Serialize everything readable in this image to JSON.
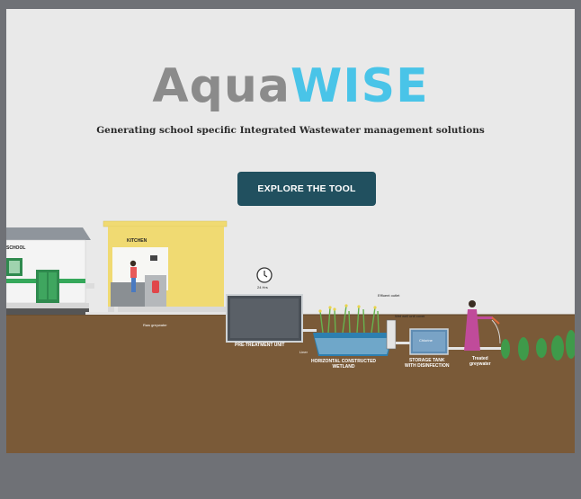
{
  "brand": {
    "part1": "Aqua",
    "part2": "WISE",
    "primary_color": "#8b8b8b",
    "accent_color": "#49c4e8"
  },
  "tagline": "Generating school specific Integrated Wastewater management solutions",
  "cta": {
    "label": "EXPLORE THE TOOL",
    "color": "#21505f"
  },
  "illustration": {
    "school_label": "SCHOOL",
    "kitchen_label": "KITCHEN",
    "timer_label": "24 Hrs",
    "raw_greywater_label": "Raw greywater",
    "pretreatment_label": "PRE-TREATMENT UNIT",
    "liner_label": "Liner",
    "wetland_label_line1": "HORIZONTAL CONSTRUCTED",
    "wetland_label_line2": "WETLAND",
    "effluent_outlet_label": "Effluent outlet",
    "wet_well_label": "Wet well unit cover",
    "chlorine_label": "Chlorine",
    "storage_label_line1": "STORAGE TANK",
    "storage_label_line2": "WITH DISINFECTION",
    "treated_label_line1": "Treated",
    "treated_label_line2": "greywater",
    "colors": {
      "soil": "#7a5a38",
      "kitchen": "#f0da72",
      "pipe": "#e4e4e4"
    }
  }
}
